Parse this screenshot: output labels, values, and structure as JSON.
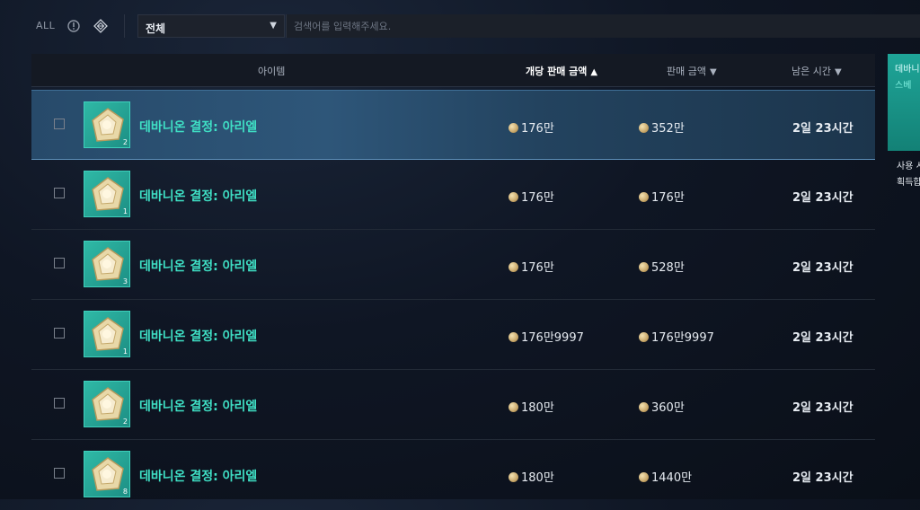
{
  "filters": {
    "all_label": "ALL",
    "icons": [
      "info-circle-icon",
      "diamond-grid-icon"
    ],
    "category_selected": "전체",
    "search_placeholder": "검색어를 입력해주세요."
  },
  "table": {
    "columns": {
      "item": "아이템",
      "unit_price": "개당 판매 금액",
      "total_price": "판매 금액",
      "time_left": "남은 시간"
    },
    "sort_arrows": {
      "unit_price": "▲",
      "total_price": "▼",
      "time_left": "▼"
    },
    "rows": [
      {
        "name": "데바니온 결정: 아리엘",
        "qty": "2",
        "unit_price": "176만",
        "total_price": "352만",
        "time_left": "2일 23시간"
      },
      {
        "name": "데바니온 결정: 아리엘",
        "qty": "1",
        "unit_price": "176만",
        "total_price": "176만",
        "time_left": "2일 23시간"
      },
      {
        "name": "데바니온 결정: 아리엘",
        "qty": "3",
        "unit_price": "176만",
        "total_price": "528만",
        "time_left": "2일 23시간"
      },
      {
        "name": "데바니온 결정: 아리엘",
        "qty": "1",
        "unit_price": "176만9997",
        "total_price": "176만9997",
        "time_left": "2일 23시간"
      },
      {
        "name": "데바니온 결정: 아리엘",
        "qty": "2",
        "unit_price": "180만",
        "total_price": "360만",
        "time_left": "2일 23시간"
      },
      {
        "name": "데바니온 결정: 아리엘",
        "qty": "8",
        "unit_price": "180만",
        "total_price": "1440만",
        "time_left": "2일 23시간"
      }
    ]
  },
  "side_panel": {
    "title": "데바니",
    "subtitle": "스베",
    "line1": "사용 시",
    "line2": "획득합"
  },
  "colors": {
    "item_name": "#3fe0c5",
    "selected_row": "#2e5679",
    "icon_bg": "#2fb9a6"
  }
}
